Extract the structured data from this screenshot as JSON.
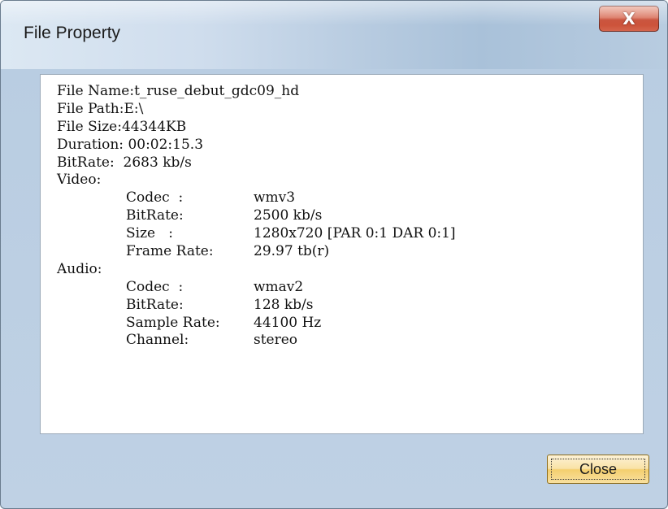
{
  "window": {
    "title": "File Property",
    "close_glyph": "X"
  },
  "info": {
    "file_name_label": "File Name:",
    "file_name": "t_ruse_debut_gdc09_hd",
    "file_path_label": "File Path:",
    "file_path": "E:\\",
    "file_size_label": "File Size:",
    "file_size": "44344KB",
    "duration_label": "Duration:",
    "duration": "00:02:15.3",
    "bitrate_label": "BitRate:",
    "bitrate": "2683 kb/s",
    "video": {
      "header": "Video:",
      "rows": [
        {
          "key": "Codec  :",
          "value": "wmv3"
        },
        {
          "key": "BitRate:",
          "value": "2500 kb/s"
        },
        {
          "key": "Size   :",
          "value": "1280x720 [PAR 0:1 DAR 0:1]"
        },
        {
          "key": "Frame Rate:",
          "value": "29.97 tb(r)"
        }
      ]
    },
    "audio": {
      "header": "Audio:",
      "rows": [
        {
          "key": "Codec  :",
          "value": "wmav2"
        },
        {
          "key": "BitRate:",
          "value": "128 kb/s"
        },
        {
          "key": "Sample Rate:",
          "value": "44100 Hz"
        },
        {
          "key": "Channel:",
          "value": "stereo"
        }
      ]
    }
  },
  "buttons": {
    "close_label": "Close"
  },
  "colors": {
    "close_x": "#c5432b",
    "close_button": "#f9e2a6"
  }
}
